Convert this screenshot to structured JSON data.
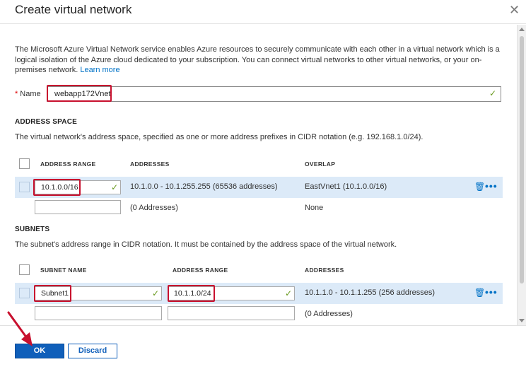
{
  "dialog": {
    "title": "Create virtual network",
    "close_glyph": "✕"
  },
  "intro": {
    "text": "The Microsoft Azure Virtual Network service enables Azure resources to securely communicate with each other in a virtual network which is a logical isolation of the Azure cloud dedicated to your subscription. You can connect virtual networks to other virtual networks, or your on-premises network.",
    "link": "Learn more"
  },
  "name_field": {
    "required_mark": "*",
    "label": "Name",
    "value": "webapp172Vnet"
  },
  "address_space": {
    "title": "ADDRESS SPACE",
    "description": "The virtual network's address space, specified as one or more address prefixes in CIDR notation (e.g. 192.168.1.0/24).",
    "columns": [
      "ADDRESS RANGE",
      "ADDRESSES",
      "OVERLAP"
    ],
    "rows": [
      {
        "range": "10.1.0.0/16",
        "addresses": "10.1.0.0 - 10.1.255.255 (65536 addresses)",
        "overlap": "EastVnet1 (10.1.0.0/16)"
      },
      {
        "range": "",
        "addresses": "(0 Addresses)",
        "overlap": "None"
      }
    ]
  },
  "subnets": {
    "title": "SUBNETS",
    "description": "The subnet's address range in CIDR notation. It must be contained by the address space of the virtual network.",
    "columns": [
      "SUBNET NAME",
      "ADDRESS RANGE",
      "ADDRESSES"
    ],
    "rows": [
      {
        "name": "Subnet1",
        "range": "10.1.1.0/24",
        "addresses": "10.1.1.0 - 10.1.1.255 (256 addresses)"
      },
      {
        "name": "",
        "range": "",
        "addresses": "(0 Addresses)"
      }
    ]
  },
  "footer": {
    "ok_label": "OK",
    "discard_label": "Discard"
  },
  "icons": {
    "check": "✓",
    "trash": "🗑",
    "more": "•••"
  },
  "colors": {
    "accent": "#0f5fba",
    "selected_row": "#dceaf8",
    "annotation_red": "#c8102e",
    "valid_check": "#6a9a1f"
  }
}
